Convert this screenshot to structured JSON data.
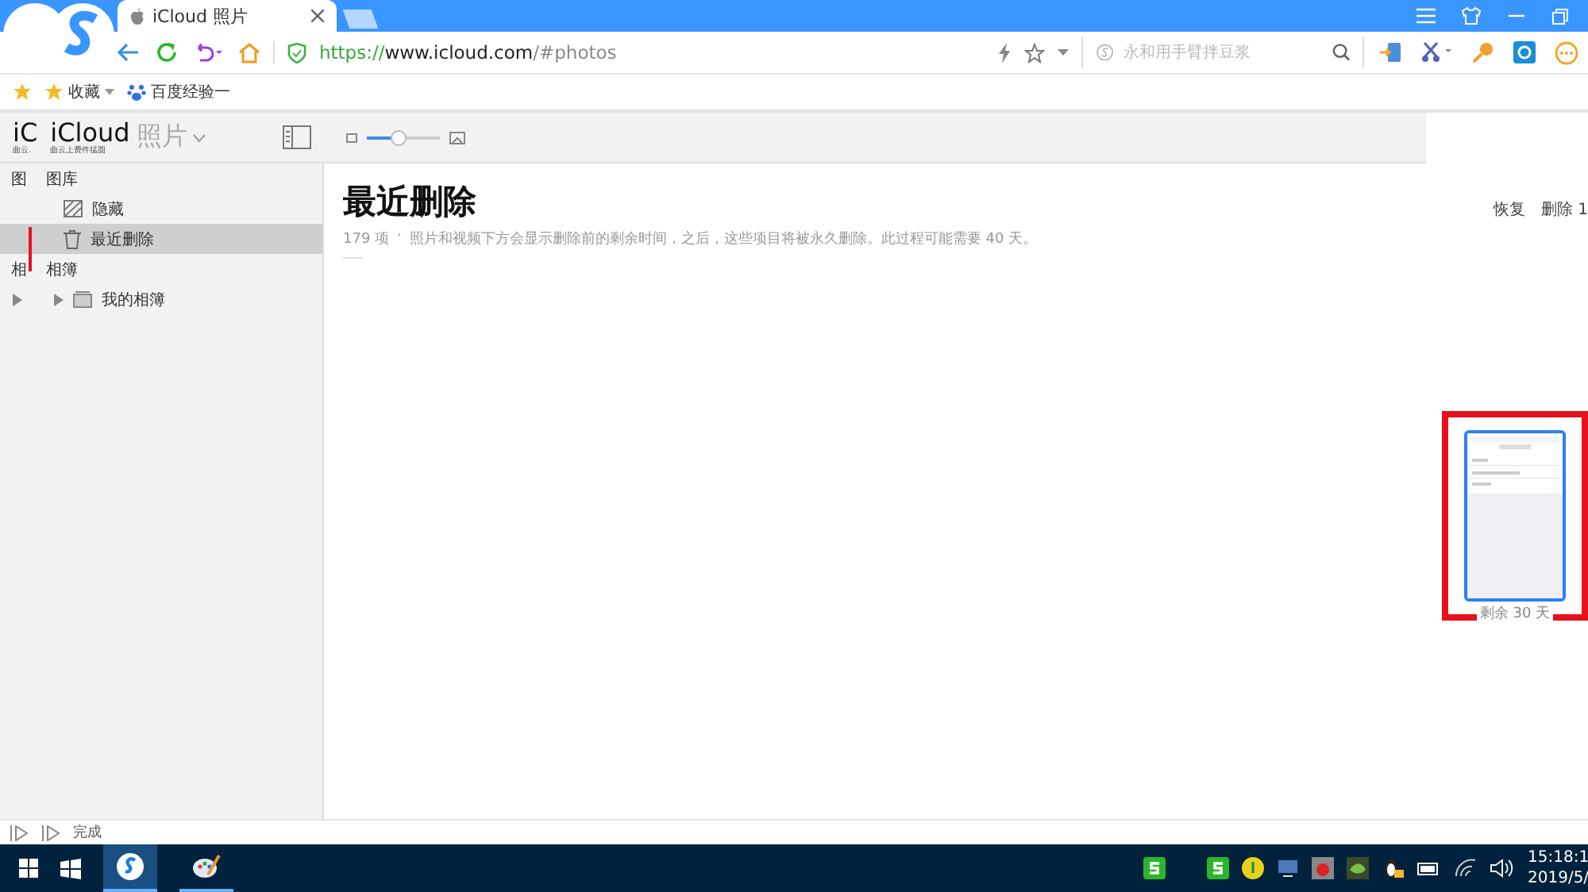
{
  "browser": {
    "tab_title": "iCloud 照片",
    "url_scheme": "https://",
    "url_host": "www.icloud.com",
    "url_path": "/#photos",
    "search_placeholder": "永和用手臂拌豆浆",
    "bookmarks": [
      {
        "label": "收藏",
        "dropdown": true
      },
      {
        "label": "百度经验一",
        "dropdown": false
      }
    ]
  },
  "app": {
    "logo_cut": "iC",
    "logo_cut_sub": "曲云.",
    "logo": "iCloud",
    "logo_sub": "曲云上费件猛圆",
    "app_name": "照片",
    "zoom": {
      "level": 0.45
    }
  },
  "sidebar": {
    "sections": [
      {
        "cut_label": "图",
        "label": "图库",
        "items": [
          {
            "label": "隐藏",
            "kind": "hidden",
            "selected": false,
            "expandable": false
          },
          {
            "label": "最近删除",
            "kind": "trash",
            "selected": true,
            "expandable": false
          }
        ]
      },
      {
        "cut_label": "相",
        "label": "相簿",
        "items": [
          {
            "label": "我的相簿",
            "kind": "album",
            "selected": false,
            "expandable": true
          }
        ]
      }
    ]
  },
  "main": {
    "title": "最近删除",
    "count": "179 项",
    "separator": "·",
    "description": "照片和视频下方会显示删除前的剩余时间，之后，这些项目将被永久删除。此过程可能需要 40 天。",
    "actions": [
      "恢复",
      "删除 1"
    ],
    "photo": {
      "kind": "picture",
      "caption": "剩余 30 天"
    }
  },
  "status_bar": {
    "text": "完成"
  },
  "taskbar": {
    "clock_time": "15:18:1",
    "clock_date": "2019/5/"
  }
}
